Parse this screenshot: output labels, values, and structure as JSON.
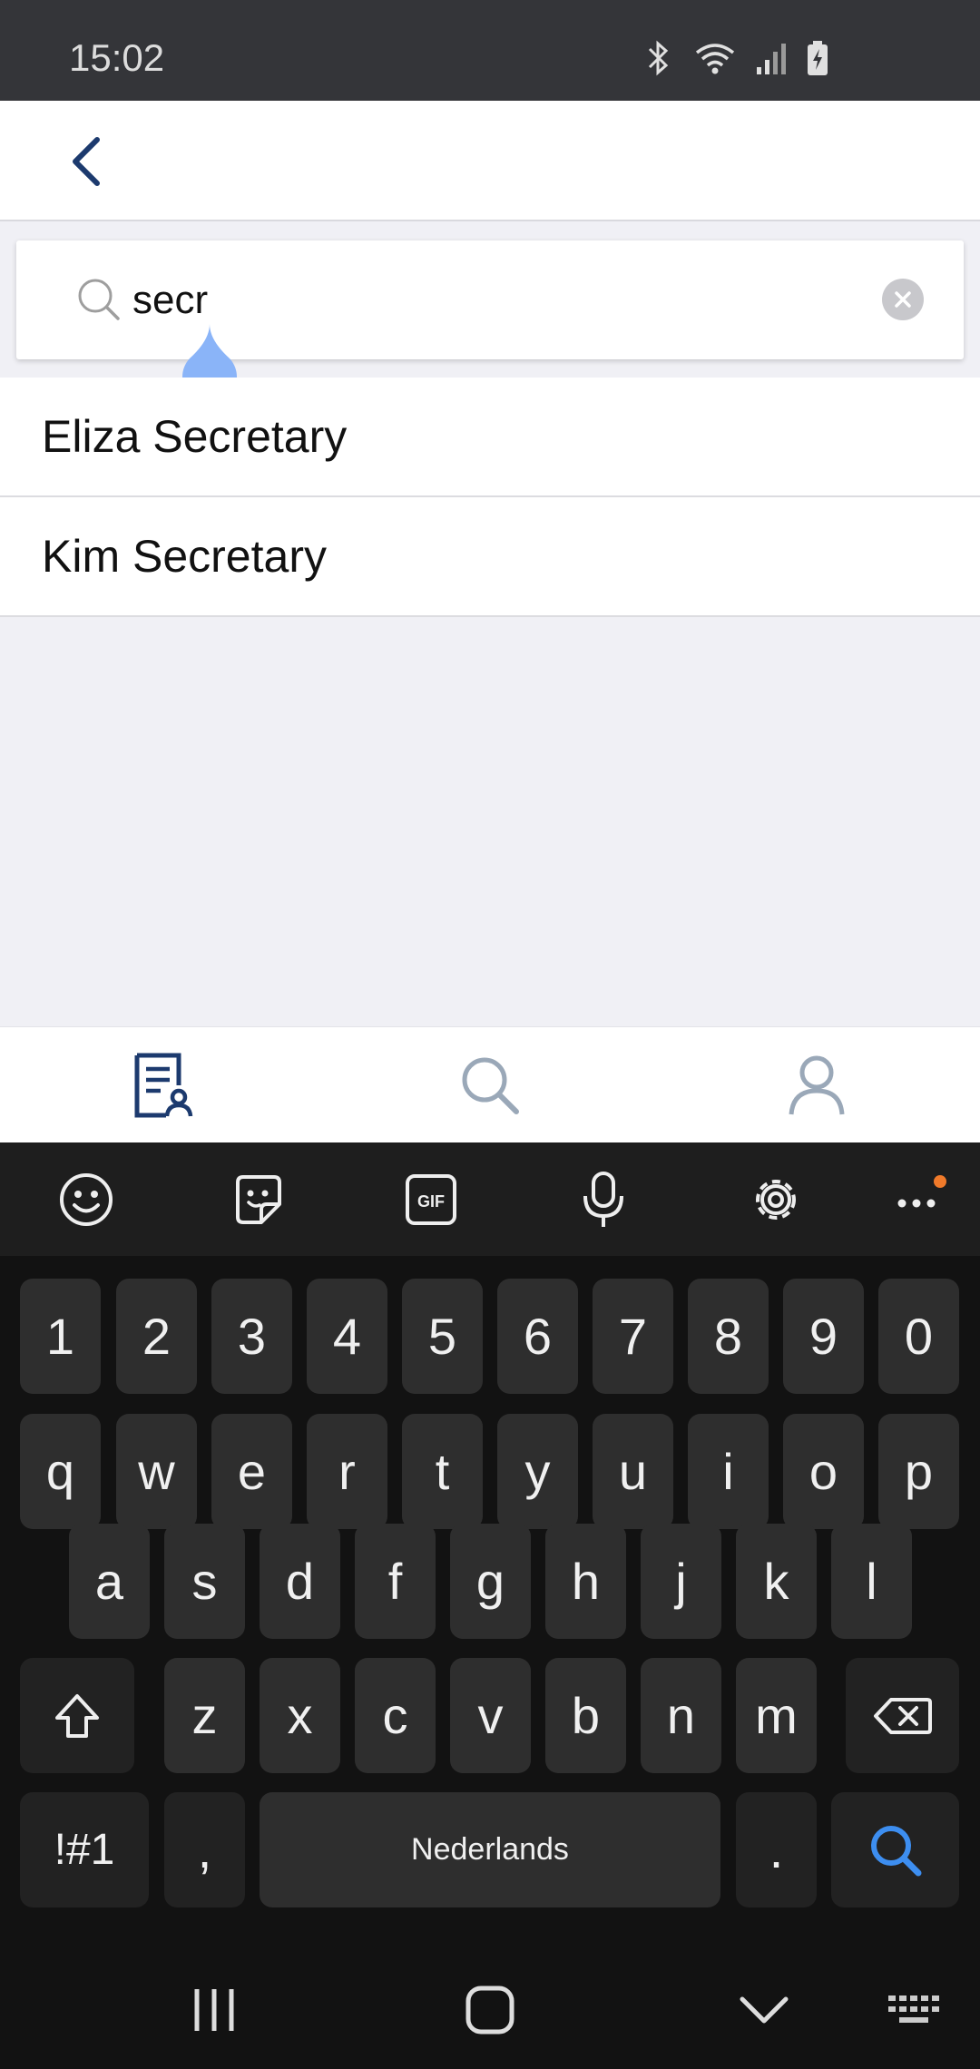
{
  "status_bar": {
    "time": "15:02",
    "icons": [
      "bluetooth-icon",
      "wifi-icon",
      "signal-icon",
      "battery-charging-icon"
    ]
  },
  "app_bar": {
    "back_icon": "chevron-left-icon"
  },
  "search": {
    "value": "secr",
    "placeholder": "",
    "icon": "search-icon",
    "clear_icon": "clear-icon"
  },
  "results": [
    {
      "label": "Eliza Secretary"
    },
    {
      "label": "Kim Secretary"
    }
  ],
  "bottom_nav": {
    "items": [
      "documents-icon",
      "search-icon",
      "profile-icon"
    ],
    "active": "documents-icon",
    "colors": {
      "active": "#1c3a6e",
      "inactive": "#9aa8b8"
    }
  },
  "keyboard": {
    "toolbar": [
      "emoji-icon",
      "sticker-icon",
      "gif-icon",
      "microphone-icon",
      "settings-icon",
      "more-icon"
    ],
    "row_numbers": [
      "1",
      "2",
      "3",
      "4",
      "5",
      "6",
      "7",
      "8",
      "9",
      "0"
    ],
    "row1": [
      "q",
      "w",
      "e",
      "r",
      "t",
      "y",
      "u",
      "i",
      "o",
      "p"
    ],
    "row2": [
      "a",
      "s",
      "d",
      "f",
      "g",
      "h",
      "j",
      "k",
      "l"
    ],
    "row3": [
      "z",
      "x",
      "c",
      "v",
      "b",
      "n",
      "m"
    ],
    "symbols_label": "!#1",
    "comma": ",",
    "space_label": "Nederlands",
    "period": ".",
    "action_color": "#3d8ef0"
  },
  "system_nav": [
    "recents-icon",
    "home-icon",
    "hide-keyboard-icon",
    "keyboard-switch-icon"
  ]
}
